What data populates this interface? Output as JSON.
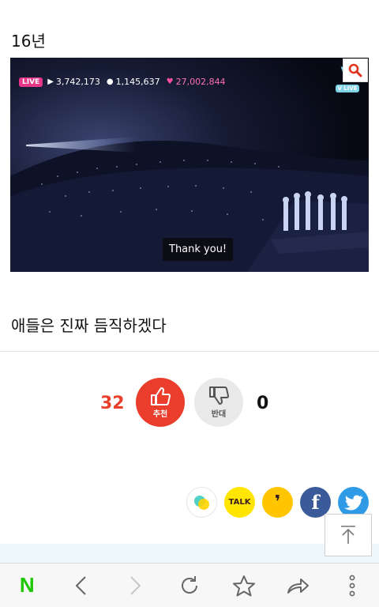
{
  "post": {
    "year_label": "16년",
    "caption": "애들은 진짜 듬직하겠다"
  },
  "video": {
    "live_badge": "LIVE",
    "plays": "3,742,173",
    "comments": "1,145,637",
    "hearts": "27,002,844",
    "vlive_label": "V LIVE",
    "subtitle": "Thank you!"
  },
  "votes": {
    "up_count": "32",
    "up_label": "추천",
    "down_count": "0",
    "down_label": "반대"
  },
  "share": {
    "talk_label": "TALK",
    "facebook_glyph": "f"
  },
  "colors": {
    "accent_red": "#ea3d2b",
    "naver_green": "#1ec800",
    "kakao_yellow": "#ffe500",
    "facebook_blue": "#3b5a99",
    "twitter_blue": "#2f9ae5"
  },
  "icons": {
    "zoom": "magnifier-icon",
    "thumbs_up": "thumbs-up-icon",
    "thumbs_down": "thumbs-down-icon",
    "back": "chevron-left-icon",
    "forward": "chevron-right-icon",
    "reload": "reload-icon",
    "bookmark": "star-icon",
    "share": "share-arrow-icon",
    "menu": "more-vertical-icon",
    "scroll_top": "arrow-up-to-top-icon"
  }
}
